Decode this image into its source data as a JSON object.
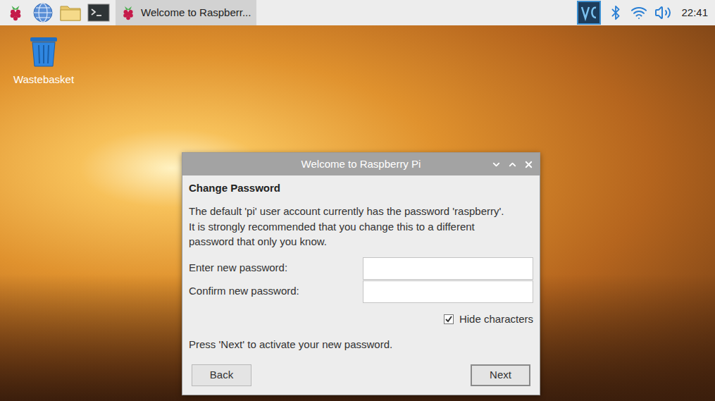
{
  "taskbar": {
    "task_button": {
      "title": "Welcome to Raspberr...",
      "active": true
    },
    "clock": "22:41"
  },
  "desktop_icons": [
    {
      "label": "Wastebasket"
    }
  ],
  "dialog": {
    "title": "Welcome to Raspberry Pi",
    "heading": "Change Password",
    "description_lines": [
      "The default 'pi' user account currently has the password 'raspberry'.",
      "It is strongly recommended that you change this to a different",
      "password that only you know."
    ],
    "fields": [
      {
        "label": "Enter new password:",
        "value": ""
      },
      {
        "label": "Confirm new password:",
        "value": ""
      }
    ],
    "checkbox": {
      "label": "Hide characters",
      "checked": true
    },
    "hint": "Press 'Next' to activate your new password.",
    "buttons": [
      {
        "label": "Back",
        "focused": false
      },
      {
        "label": "Next",
        "focused": true
      }
    ]
  }
}
